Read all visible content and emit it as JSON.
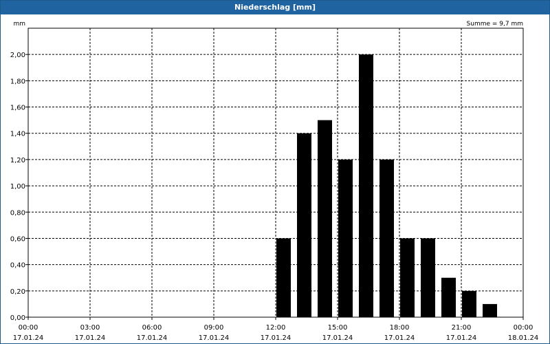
{
  "window": {
    "title": "Niederschlag [mm]"
  },
  "chart_data": {
    "type": "bar",
    "title": "Niederschlag [mm]",
    "ylabel": "mm",
    "summary": "Summe = 9,7 mm",
    "ylim": [
      0,
      2.2
    ],
    "xlim_hours": [
      0,
      24
    ],
    "grid": true,
    "bar_color": "#000000",
    "grid_color": "#000000",
    "y_ticks": [
      "0,00",
      "0,20",
      "0,40",
      "0,60",
      "0,80",
      "1,00",
      "1,20",
      "1,40",
      "1,60",
      "1,80",
      "2,00"
    ],
    "y_tick_values": [
      0,
      0.2,
      0.4,
      0.6,
      0.8,
      1.0,
      1.2,
      1.4,
      1.6,
      1.8,
      2.0
    ],
    "x_ticks": [
      {
        "time": "00:00",
        "date": "17.01.24"
      },
      {
        "time": "03:00",
        "date": "17.01.24"
      },
      {
        "time": "06:00",
        "date": "17.01.24"
      },
      {
        "time": "09:00",
        "date": "17.01.24"
      },
      {
        "time": "12:00",
        "date": "17.01.24"
      },
      {
        "time": "15:00",
        "date": "17.01.24"
      },
      {
        "time": "18:00",
        "date": "17.01.24"
      },
      {
        "time": "21:00",
        "date": "17.01.24"
      },
      {
        "time": "00:00",
        "date": "18.01.24"
      }
    ],
    "x": [
      "12:00",
      "13:00",
      "14:00",
      "15:00",
      "16:00",
      "17:00",
      "18:00",
      "19:00",
      "20:00",
      "21:00",
      "22:00"
    ],
    "values": [
      0.6,
      1.4,
      1.5,
      1.2,
      2.0,
      1.2,
      0.6,
      0.6,
      0.3,
      0.2,
      0.1
    ]
  }
}
